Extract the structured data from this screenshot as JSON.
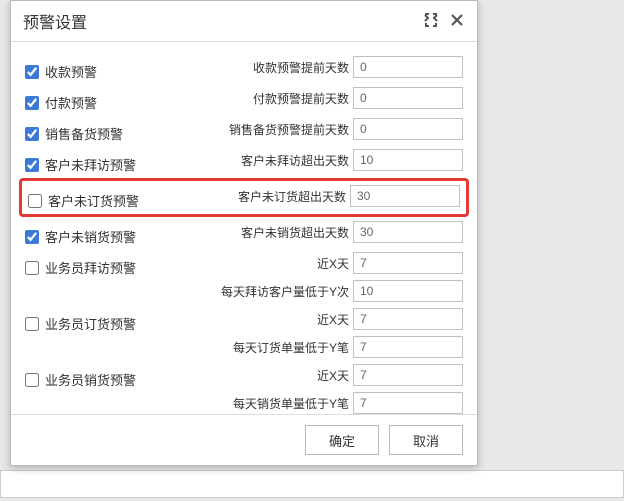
{
  "dialog": {
    "title": "预警设置",
    "ok": "确定",
    "cancel": "取消"
  },
  "rows": [
    {
      "checkbox_label": "收款预警",
      "checked": true,
      "fields": [
        {
          "label": "收款预警提前天数",
          "value": "0"
        }
      ]
    },
    {
      "checkbox_label": "付款预警",
      "checked": true,
      "fields": [
        {
          "label": "付款预警提前天数",
          "value": "0"
        }
      ]
    },
    {
      "checkbox_label": "销售备货预警",
      "checked": true,
      "fields": [
        {
          "label": "销售备货预警提前天数",
          "value": "0"
        }
      ]
    },
    {
      "checkbox_label": "客户未拜访预警",
      "checked": true,
      "fields": [
        {
          "label": "客户未拜访超出天数",
          "value": "10"
        }
      ]
    },
    {
      "checkbox_label": "客户未订货预警",
      "checked": false,
      "highlight": true,
      "fields": [
        {
          "label": "客户未订货超出天数",
          "value": "30"
        }
      ]
    },
    {
      "checkbox_label": "客户未销货预警",
      "checked": true,
      "fields": [
        {
          "label": "客户未销货超出天数",
          "value": "30"
        }
      ]
    },
    {
      "checkbox_label": "业务员拜访预警",
      "checked": false,
      "fields": [
        {
          "label": "近X天",
          "value": "7"
        },
        {
          "label": "每天拜访客户量低于Y次",
          "value": "10"
        }
      ]
    },
    {
      "checkbox_label": "业务员订货预警",
      "checked": false,
      "fields": [
        {
          "label": "近X天",
          "value": "7"
        },
        {
          "label": "每天订货单量低于Y笔",
          "value": "7"
        }
      ]
    },
    {
      "checkbox_label": "业务员销货预警",
      "checked": false,
      "fields": [
        {
          "label": "近X天",
          "value": "7"
        },
        {
          "label": "每天销货单量低于Y笔",
          "value": "7"
        }
      ]
    }
  ]
}
